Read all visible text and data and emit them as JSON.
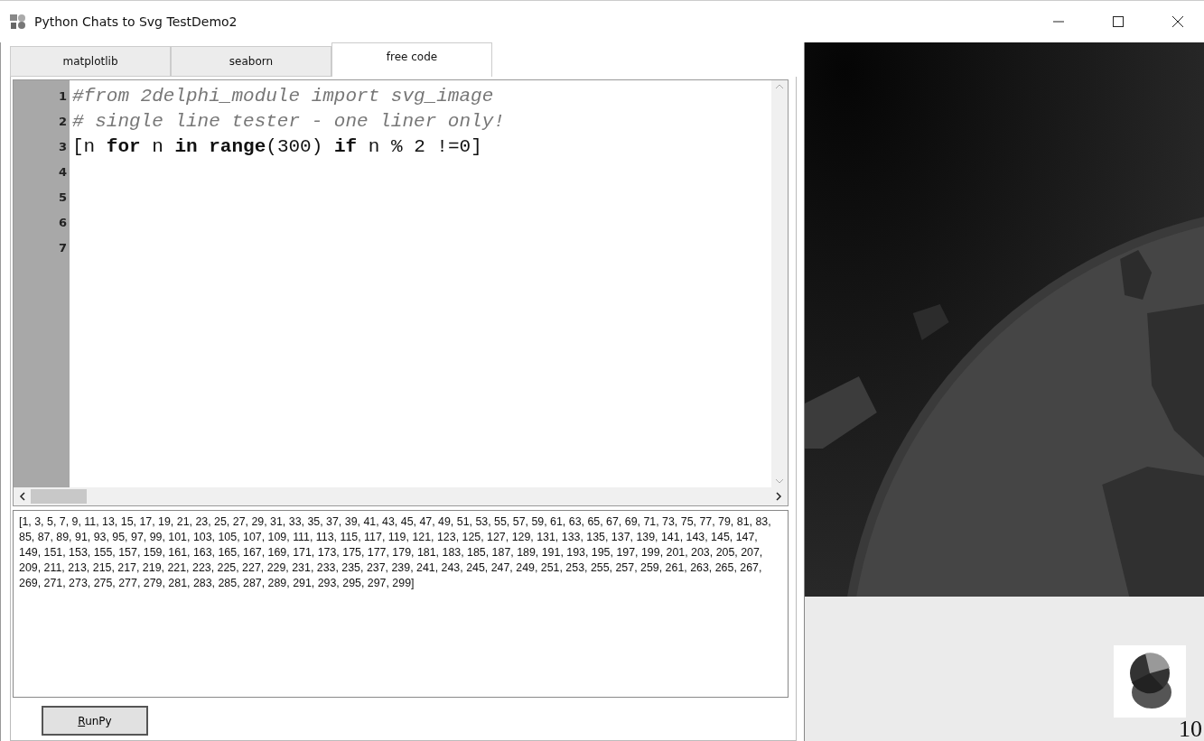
{
  "window": {
    "title": "Python Chats to Svg TestDemo2"
  },
  "tabs": [
    {
      "label": "matplotlib",
      "selected": false
    },
    {
      "label": "seaborn",
      "selected": false
    },
    {
      "label": "free code",
      "selected": true
    }
  ],
  "editor": {
    "lines": [
      {
        "number": "1",
        "kind": "comment",
        "text": "#from 2delphi_module import svg_image"
      },
      {
        "number": "2",
        "kind": "comment",
        "text": "# single line tester - one liner only!"
      },
      {
        "number": "3",
        "kind": "code",
        "text": "[n **for** n **in** **range**(300) **if** n % 2 !=0]"
      },
      {
        "number": "4",
        "kind": "empty"
      },
      {
        "number": "5",
        "kind": "empty"
      },
      {
        "number": "6",
        "kind": "empty"
      },
      {
        "number": "7",
        "kind": "empty"
      }
    ]
  },
  "output": {
    "text": "[1, 3, 5, 7, 9, 11, 13, 15, 17, 19, 21, 23, 25, 27, 29, 31, 33, 35, 37, 39, 41, 43, 45, 47, 49, 51, 53, 55, 57, 59, 61, 63, 65, 67, 69, 71, 73, 75, 77, 79, 81, 83, 85, 87, 89, 91, 93, 95, 97, 99, 101, 103, 105, 107, 109, 111, 113, 115, 117, 119, 121, 123, 125, 127, 129, 131, 133, 135, 137, 139, 141, 143, 145, 147, 149, 151, 153, 155, 157, 159, 161, 163, 165, 167, 169, 171, 173, 175, 177, 179, 181, 183, 185, 187, 189, 191, 193, 195, 197, 199, 201, 203, 205, 207, 209, 211, 213, 215, 217, 219, 221, 223, 225, 227, 229, 231, 233, 235, 237, 239, 241, 243, 245, 247, 249, 251, 253, 255, 257, 259, 261, 263, 265, 267, 269, 271, 273, 275, 277, 279, 281, 283, 285, 287, 289, 291, 293, 295, 297, 299]"
  },
  "run_button": {
    "label": "RunPy"
  },
  "corner_number": "10"
}
